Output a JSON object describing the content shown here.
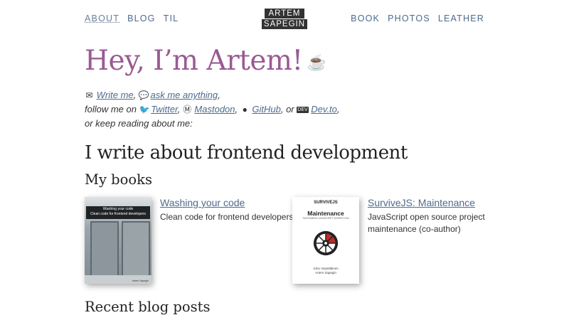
{
  "nav": {
    "left": [
      "About",
      "Blog",
      "TIL"
    ],
    "right": [
      "Book",
      "Photos",
      "Leather"
    ],
    "logo_line1": "ARTEM",
    "logo_line2": "SAPEGIN"
  },
  "hero": {
    "title": "Hey, I’m Artem!",
    "cup_icon": "coffee-cup-icon"
  },
  "intro": {
    "write_me": "Write me",
    "ask_me": "ask me anything",
    "follow_prefix": "follow me on",
    "twitter": "Twitter",
    "mastodon": "Mastodon",
    "github": "GitHub",
    "or": ", or",
    "devto": "Dev.to",
    "devto_icon_text": "DEV",
    "keep_reading": "or keep reading about me:"
  },
  "section_title": "I write about frontend development",
  "books_title": "My books",
  "books": [
    {
      "title": "Washing your code",
      "description": "Clean code for frontend developers",
      "cover_title": "Washing your code",
      "cover_subtitle": "Clean code for frontend developers",
      "cover_author": "Artem Sapegin"
    },
    {
      "title": "SurviveJS: Maintenance",
      "description": "JavaScript open source project maintenance (co-author)",
      "cover_brand": "SURVIVEJS",
      "cover_title": "Maintenance",
      "cover_subtitle": "SUSTAINING JAVASCRIPT WORKFLOW",
      "cover_author1": "Juho Vepsäläinen",
      "cover_author2": "Artem Sapegin"
    }
  ],
  "posts_title": "Recent blog posts",
  "colors": {
    "accent": "#9a5a93",
    "link": "#4d6a8c"
  }
}
